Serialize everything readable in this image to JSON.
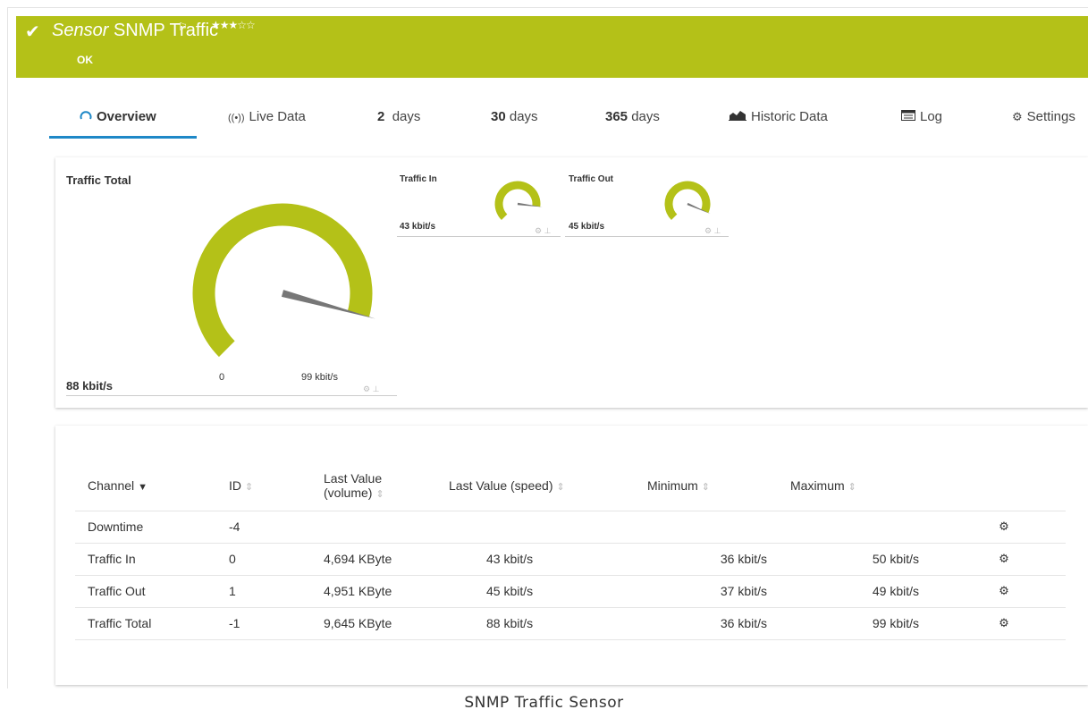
{
  "header": {
    "sensor_word": "Sensor",
    "sensor_name": "SNMP Traffic",
    "status": "OK",
    "stars": "★★★☆☆",
    "accent_color": "#b4c118"
  },
  "tabs": [
    {
      "icon": "gauge-icon",
      "label": "Overview"
    },
    {
      "icon": "live-data-icon",
      "label": "Live Data"
    },
    {
      "num": "2",
      "label": "days"
    },
    {
      "num": "30",
      "label": "days"
    },
    {
      "num": "365",
      "label": "days"
    },
    {
      "icon": "chart-icon",
      "label": "Historic Data"
    },
    {
      "icon": "log-icon",
      "label": "Log"
    },
    {
      "icon": "gear-icon",
      "label": "Settings"
    }
  ],
  "gauges": {
    "total": {
      "title": "Traffic Total",
      "value": "88 kbit/s",
      "min": "0",
      "max": "99 kbit/s",
      "fraction": 0.89
    },
    "in": {
      "title": "Traffic In",
      "value": "43 kbit/s",
      "fraction": 0.86
    },
    "out": {
      "title": "Traffic Out",
      "value": "45 kbit/s",
      "fraction": 0.92
    }
  },
  "table": {
    "headers": [
      "Channel",
      "ID",
      "Last Value (volume)",
      "Last Value (speed)",
      "Minimum",
      "Maximum"
    ],
    "header_lines": {
      "volume_line1": "Last Value",
      "volume_line2": "(volume)"
    },
    "rows": [
      {
        "channel": "Downtime",
        "id": "-4",
        "volume": "",
        "speed": "",
        "min": "",
        "max": ""
      },
      {
        "channel": "Traffic In",
        "id": "0",
        "volume": "4,694 KByte",
        "speed": "43 kbit/s",
        "min": "36 kbit/s",
        "max": "50 kbit/s"
      },
      {
        "channel": "Traffic Out",
        "id": "1",
        "volume": "4,951 KByte",
        "speed": "45 kbit/s",
        "min": "37 kbit/s",
        "max": "49 kbit/s"
      },
      {
        "channel": "Traffic Total",
        "id": "-1",
        "volume": "9,645 KByte",
        "speed": "88 kbit/s",
        "min": "36 kbit/s",
        "max": "99 kbit/s"
      }
    ]
  },
  "caption": "SNMP Traffic Sensor"
}
